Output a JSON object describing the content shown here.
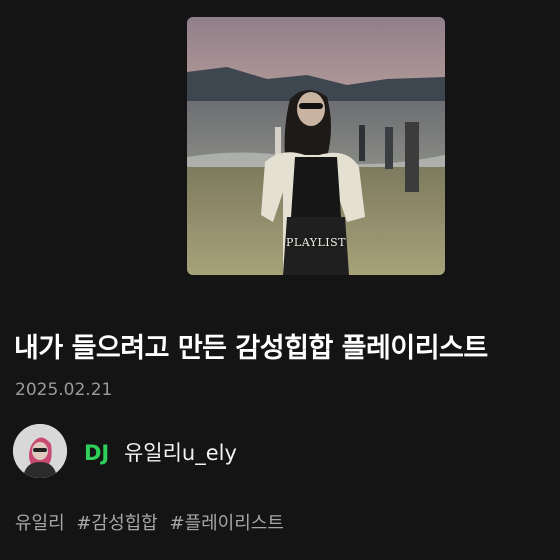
{
  "playlist": {
    "cover_label": "PLAYLIST",
    "title": "내가 들으려고 만든 감성힙합 플레이리스트",
    "date": "2025.02.21"
  },
  "dj": {
    "badge": "DJ",
    "name": "유일리u_ely"
  },
  "tags": [
    "유일리",
    "#감성힙합",
    "#플레이리스트"
  ],
  "colors": {
    "background": "#141414",
    "dj_badge": "#2fd15a",
    "date": "#9a9a9a",
    "tags": "#a6a6a6"
  }
}
